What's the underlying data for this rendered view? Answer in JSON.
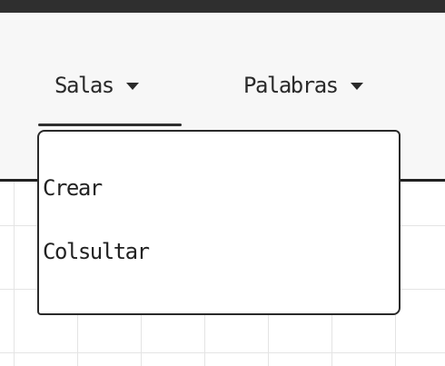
{
  "navbar": {
    "items": [
      {
        "label": "Salas",
        "icon": "caret-down-icon",
        "expanded": true
      },
      {
        "label": "Palabras",
        "icon": "caret-down-icon",
        "expanded": false
      }
    ]
  },
  "dropdown": {
    "items": [
      {
        "label": "Crear"
      },
      {
        "label": "Colsultar"
      }
    ]
  },
  "colors": {
    "topbar": "#2f2f2f",
    "navbar_bg": "#f7f7f7",
    "text": "#222222",
    "grid_line": "#e4e4e4"
  }
}
